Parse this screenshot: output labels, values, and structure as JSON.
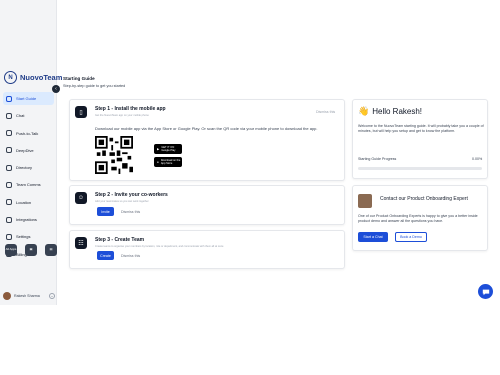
{
  "brand": {
    "name": "NuovoTeam",
    "logo_letter": "N"
  },
  "sidebar": {
    "items": [
      {
        "label": "Start Guide",
        "icon": "rocket-icon",
        "active": true
      },
      {
        "label": "Chat",
        "icon": "chat-icon"
      },
      {
        "label": "Push-to-Talk",
        "icon": "microphone-icon"
      },
      {
        "label": "DeepDive",
        "icon": "deepdive-icon"
      },
      {
        "label": "Directory",
        "icon": "directory-icon"
      },
      {
        "label": "Team Comms",
        "icon": "megaphone-icon"
      },
      {
        "label": "Location",
        "icon": "location-pin-icon"
      },
      {
        "label": "Integrations",
        "icon": "plug-icon"
      },
      {
        "label": "Settings",
        "icon": "gear-icon"
      },
      {
        "label": "Billing",
        "icon": "card-icon"
      }
    ],
    "actions": [
      {
        "label": "All Apps",
        "icon": "grid-icon"
      },
      {
        "label": "",
        "icon": "cube-icon"
      },
      {
        "label": "",
        "icon": "box-icon"
      }
    ],
    "user": {
      "name": "Rakesh Sharma"
    }
  },
  "header": {
    "title": "Starting Guide",
    "subtitle": "Step-by-step guide to get you started"
  },
  "steps": [
    {
      "title": "Step 1 - Install the mobile app",
      "desc": "Get the NuovoTeam app on your mobile phone",
      "dismiss": "Dismiss this",
      "body": "Download our mobile app via the App Store or Google Play. Or scan the QR code via your mobile phone to download the app.",
      "stores": [
        "GET IT ON Google Play",
        "Download on the App Store"
      ]
    },
    {
      "title": "Step 2 - Invite your co-workers",
      "desc": "Add your teammates so you can work together",
      "primary": "Invite",
      "secondary": "Dismiss this"
    },
    {
      "title": "Step 3 - Create Team",
      "desc": "Create teams to organise your members by location, role or department, and communicate with them all at once",
      "primary": "Create",
      "secondary": "Dismiss this"
    }
  ],
  "welcome": {
    "title": "Hello Rakesh!",
    "text": "Welcome to the NuovoTeam starting guide. It will probably take you a couple of minutes, but will help you setup and get to know the platform.",
    "progress_label": "Starting Guide Progress",
    "progress_value": "0.00%",
    "progress_fraction": 0
  },
  "expert": {
    "title": "Contact our Product Onboarding Expert",
    "text": "One of our Product Onboarding Experts is happy to give you a better inside product demo and answer all the questions you have.",
    "primary": "Start a Chat",
    "secondary": "Book a Demo"
  },
  "colors": {
    "accent": "#1d4ed8",
    "brand": "#1f3c88"
  }
}
